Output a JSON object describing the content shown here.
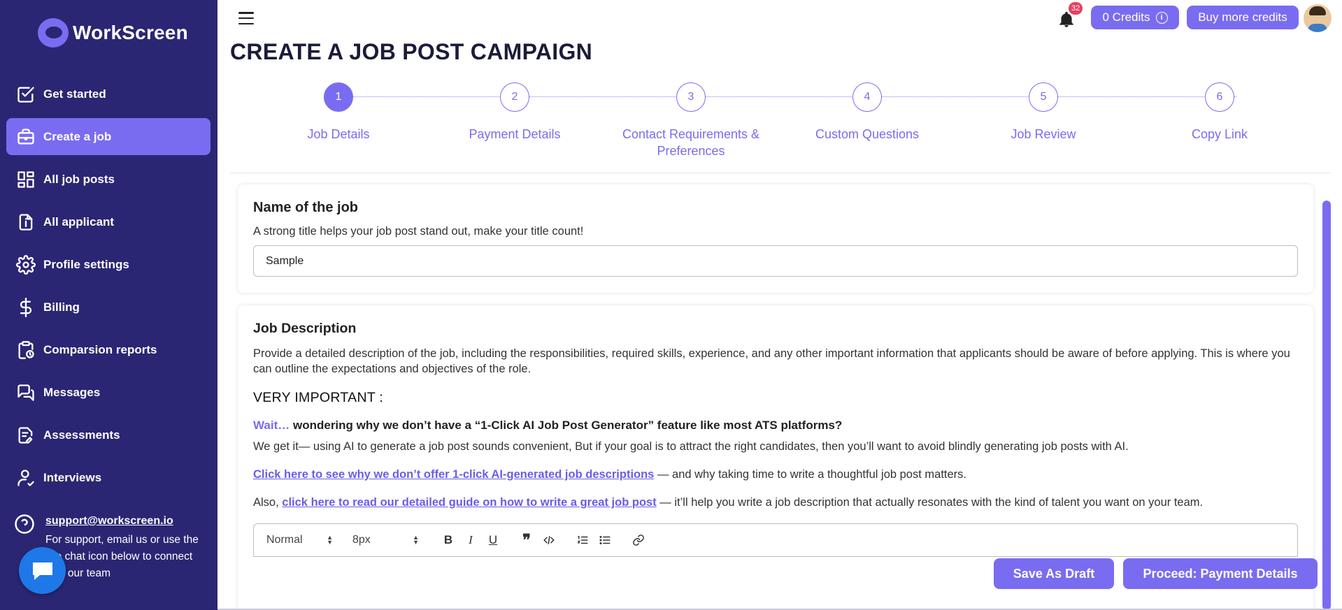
{
  "app": {
    "logo_text": "WorkScreen",
    "brand_color": "#2a2673",
    "accent_color": "#7a6cf0"
  },
  "sidebar": {
    "items": [
      {
        "label": "Get started",
        "icon": "checkbox-icon",
        "active": false
      },
      {
        "label": "Create a job",
        "icon": "briefcase-icon",
        "active": true
      },
      {
        "label": "All job posts",
        "icon": "dashboard-grid-icon",
        "active": false
      },
      {
        "label": "All applicant",
        "icon": "document-info-icon",
        "active": false
      },
      {
        "label": "Profile settings",
        "icon": "gear-icon",
        "active": false
      },
      {
        "label": "Billing",
        "icon": "dollar-icon",
        "active": false
      },
      {
        "label": "Comparsion reports",
        "icon": "clipboard-clock-icon",
        "active": false
      },
      {
        "label": "Messages",
        "icon": "chat-bubbles-icon",
        "active": false
      },
      {
        "label": "Assessments",
        "icon": "document-edit-icon",
        "active": false
      },
      {
        "label": "Interviews",
        "icon": "user-check-icon",
        "active": false
      }
    ],
    "support": {
      "email": "support@workscreen.io",
      "text": "For support, email us or use the live chat icon below to connect with our team"
    }
  },
  "topbar": {
    "notification_count": "32",
    "credits_label": "0 Credits",
    "buy_label": "Buy more credits"
  },
  "page": {
    "title": "CREATE A JOB POST CAMPAIGN"
  },
  "stepper": {
    "current": 1,
    "steps": [
      {
        "number": "1",
        "label": "Job Details"
      },
      {
        "number": "2",
        "label": "Payment Details"
      },
      {
        "number": "3",
        "label": "Contact Requirements & Preferences"
      },
      {
        "number": "4",
        "label": "Custom Questions"
      },
      {
        "number": "5",
        "label": "Job Review"
      },
      {
        "number": "6",
        "label": "Copy Link"
      }
    ]
  },
  "job_name": {
    "heading": "Name of the job",
    "subtitle": "A strong title helps your job post stand out, make your title count!",
    "value": "Sample"
  },
  "job_description": {
    "heading": "Job Description",
    "subtitle": "Provide a detailed description of the job, including the responsibilities, required skills, experience, and any other important information that applicants should be aware of before applying. This is where you can outline the expectations and objectives of the role.",
    "very_important": "VERY IMPORTANT :",
    "wait_prefix": "Wait…",
    "wait_text": " wondering why we don’t have a “1-Click AI Job Post Generator” feature like most ATS platforms?",
    "explain_text": "We get it— using AI to generate a job post sounds convenient, But if your goal is to attract the right candidates, then you’ll want to avoid blindly generating job posts with AI.",
    "link1_text": "Click here to see why we don’t offer 1-click AI-generated job descriptions",
    "link1_suffix": " — and why taking time to write a thoughtful job post matters.",
    "also_prefix": "Also, ",
    "link2_text": "click here to read our detailed guide on how to write a great job post",
    "link2_suffix": " — it’ll help you write a job description that actually resonates with the kind of talent you want on your team.",
    "toolbar": {
      "format": "Normal",
      "size": "8px"
    }
  },
  "actions": {
    "draft_label": "Save As Draft",
    "proceed_label": "Proceed: Payment Details"
  }
}
